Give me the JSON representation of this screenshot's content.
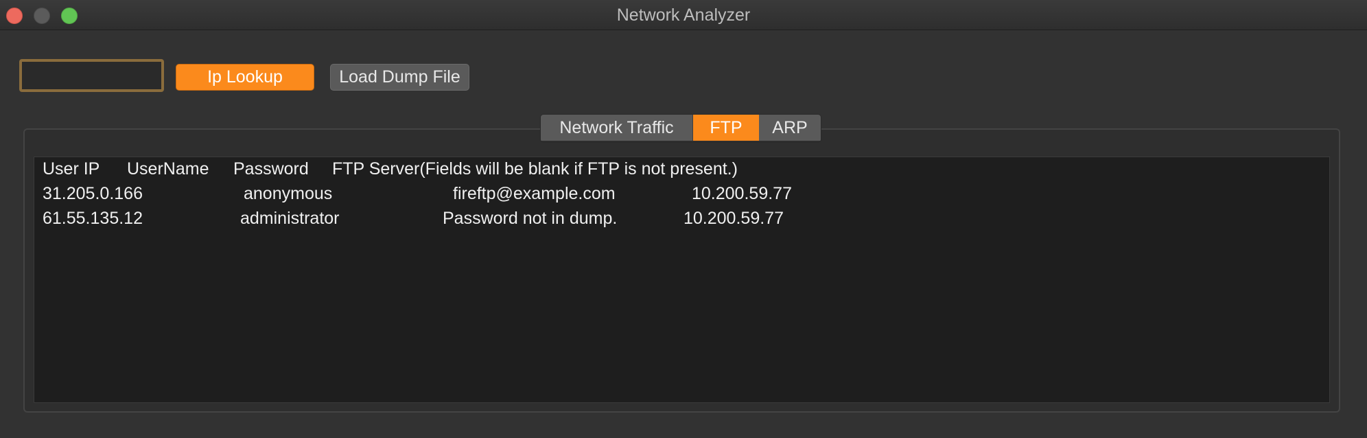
{
  "window": {
    "title": "Network Analyzer"
  },
  "toolbar": {
    "ip_input_value": "",
    "ip_lookup_label": "Ip Lookup",
    "load_dump_label": "Load Dump File"
  },
  "tabs": [
    {
      "label": "Network Traffic",
      "active": false
    },
    {
      "label": "FTP",
      "active": true
    },
    {
      "label": "ARP",
      "active": false
    }
  ],
  "ftp_table": {
    "header": [
      "User IP",
      "UserName",
      "Password",
      "FTP Server(Fields will be blank if FTP is not present.)"
    ],
    "rows": [
      [
        "31.205.0.166",
        "anonymous",
        "fireftp@example.com",
        "10.200.59.77"
      ],
      [
        "61.55.135.12",
        "administrator",
        "Password not in dump.",
        "10.200.59.77"
      ]
    ]
  },
  "colors": {
    "accent": "#fb8a1c",
    "window_bg": "#323232",
    "text_area_bg": "#1e1e1e"
  }
}
